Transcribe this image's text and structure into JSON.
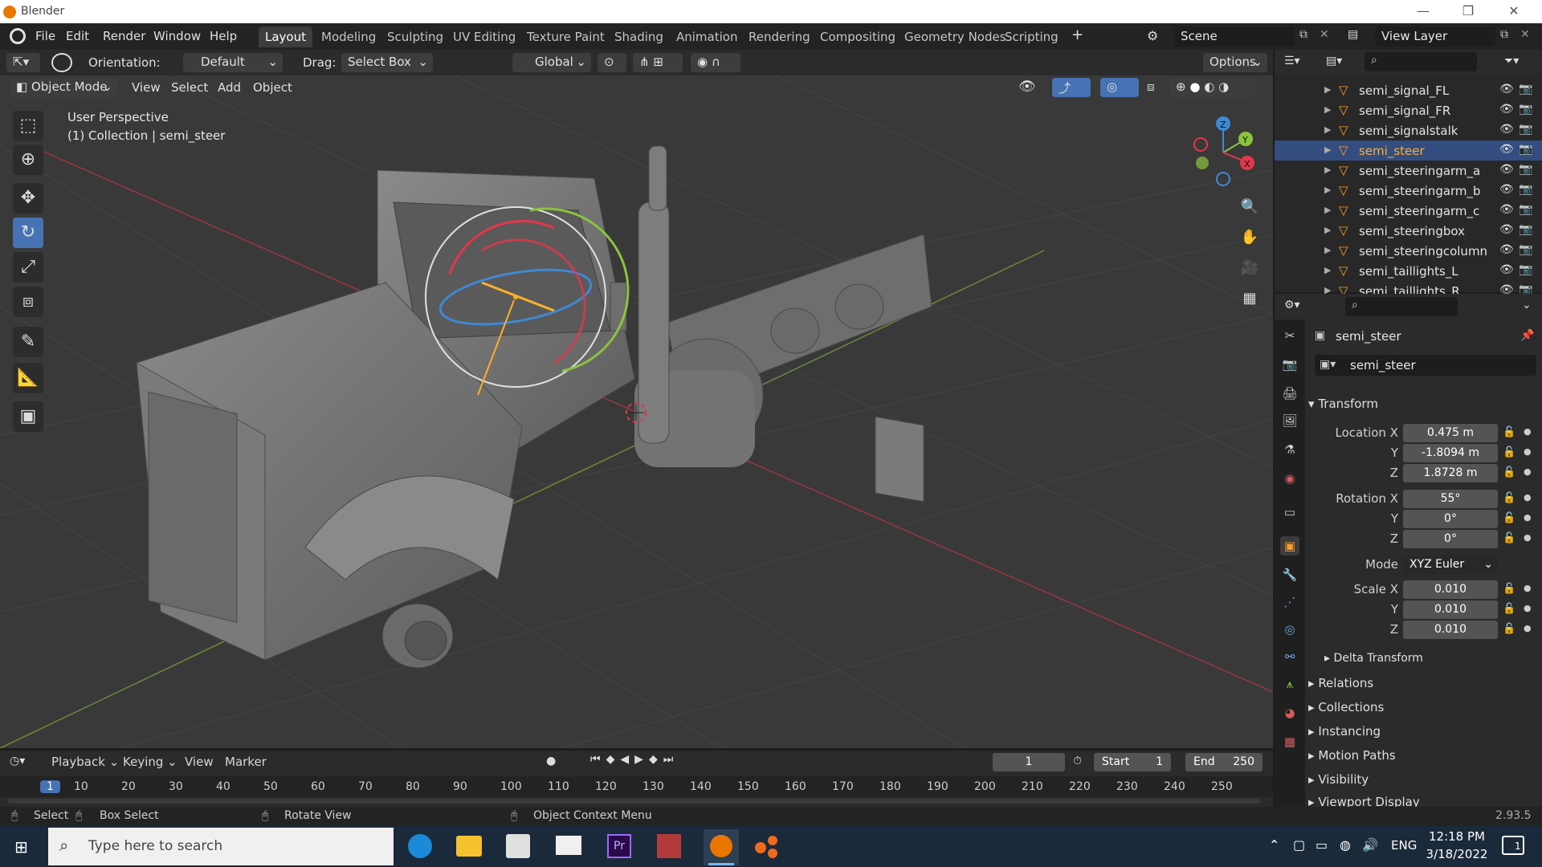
{
  "window": {
    "title": "Blender"
  },
  "menu": [
    "File",
    "Edit",
    "Render",
    "Window",
    "Help"
  ],
  "workspaces": [
    "Layout",
    "Modeling",
    "Sculpting",
    "UV Editing",
    "Texture Paint",
    "Shading",
    "Animation",
    "Rendering",
    "Compositing",
    "Geometry Nodes",
    "Scripting"
  ],
  "scene": {
    "name": "Scene",
    "view_layer": "View Layer"
  },
  "viewport_header": {
    "orientation_label": "Orientation:",
    "orientation_value": "Default",
    "drag_label": "Drag:",
    "drag_value": "Select Box",
    "transform_orientation": "Global",
    "options": "Options"
  },
  "viewport_menu": {
    "mode": "Object Mode",
    "items": [
      "View",
      "Select",
      "Add",
      "Object"
    ]
  },
  "viewport_info": {
    "line1": "User Perspective",
    "line2": "(1) Collection | semi_steer"
  },
  "outliner": {
    "items": [
      {
        "name": "semi_signal_FL",
        "selected": false
      },
      {
        "name": "semi_signal_FR",
        "selected": false
      },
      {
        "name": "semi_signalstalk",
        "selected": false
      },
      {
        "name": "semi_steer",
        "selected": true
      },
      {
        "name": "semi_steeringarm_a",
        "selected": false
      },
      {
        "name": "semi_steeringarm_b",
        "selected": false
      },
      {
        "name": "semi_steeringarm_c",
        "selected": false
      },
      {
        "name": "semi_steeringbox",
        "selected": false
      },
      {
        "name": "semi_steeringcolumn",
        "selected": false
      },
      {
        "name": "semi_taillights_L",
        "selected": false
      },
      {
        "name": "semi_taillights_R",
        "selected": false
      }
    ]
  },
  "properties": {
    "object_name": "semi_steer",
    "data_name": "semi_steer",
    "transform_title": "Transform",
    "location_label": "Location X",
    "location": {
      "x": "0.475 m",
      "y": "-1.8094 m",
      "z": "1.8728 m"
    },
    "rotation_label": "Rotation X",
    "rotation": {
      "x": "55°",
      "y": "0°",
      "z": "0°"
    },
    "mode_label": "Mode",
    "mode_value": "XYZ Euler",
    "scale_label": "Scale X",
    "scale": {
      "x": "0.010",
      "y": "0.010",
      "z": "0.010"
    },
    "y_label": "Y",
    "z_label": "Z",
    "delta_transform": "Delta Transform",
    "sections": [
      "Relations",
      "Collections",
      "Instancing",
      "Motion Paths",
      "Visibility",
      "Viewport Display"
    ]
  },
  "timeline": {
    "menus": [
      "Playback",
      "Keying",
      "View",
      "Marker"
    ],
    "current_frame": "1",
    "start_label": "Start",
    "start": "1",
    "end_label": "End",
    "end": "250",
    "ruler": [
      "1",
      "10",
      "20",
      "30",
      "40",
      "50",
      "60",
      "70",
      "80",
      "90",
      "100",
      "110",
      "120",
      "130",
      "140",
      "150",
      "160",
      "170",
      "180",
      "190",
      "200",
      "210",
      "220",
      "230",
      "240",
      "250"
    ]
  },
  "statusbar": {
    "select": "Select",
    "box_select": "Box Select",
    "rotate_view": "Rotate View",
    "context_menu": "Object Context Menu",
    "version": "2.93.5"
  },
  "taskbar": {
    "search_placeholder": "Type here to search",
    "language": "ENG",
    "time": "12:18 PM",
    "date": "3/18/2022",
    "notification_count": "1"
  },
  "colors": {
    "accent": "#4772b3",
    "selection": "#ffaf29",
    "axis_x": "#e3364c",
    "axis_y": "#8bc43d",
    "axis_z": "#3f88d4"
  }
}
